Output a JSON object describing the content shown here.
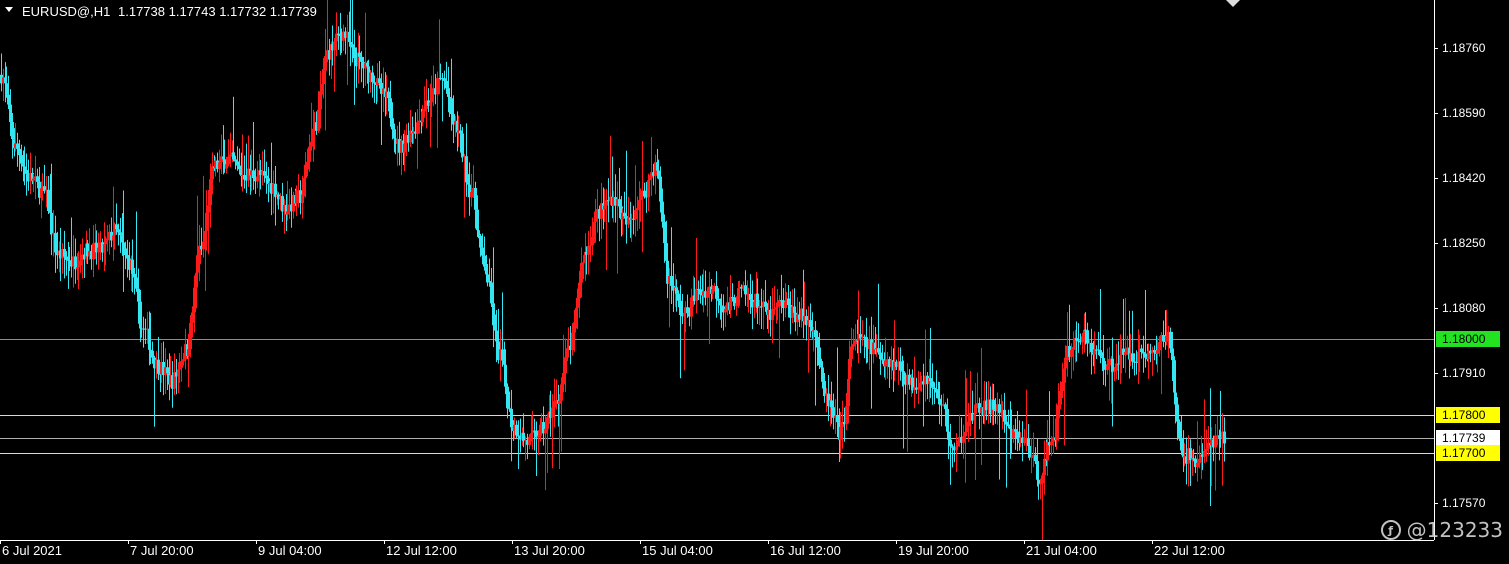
{
  "header": {
    "symbol": "EURUSD@,H1",
    "ohlc": "1.17738 1.17743 1.17732 1.17739",
    "menu_icon": "triangle-down-icon"
  },
  "watermark": {
    "text": "@123233",
    "icon": "brand-logo-icon"
  },
  "colors": {
    "background": "#000000",
    "bull": "#ff1a1a",
    "bear": "#33e6f2",
    "axis": "#ffffff",
    "green_line": "#2ecc40",
    "yellow_line": "#e8e85a",
    "current_line": "#b0b0b0"
  },
  "chart_data": {
    "type": "candlestick",
    "title": "",
    "xlabel": "",
    "ylabel": "",
    "ylim": [
      1.175,
      1.1888
    ],
    "y_ticks": [
      "1.18760",
      "1.18590",
      "1.18420",
      "1.18250",
      "1.18080",
      "1.17910",
      "1.17570"
    ],
    "x_ticks": [
      "6 Jul 2021",
      "7 Jul 20:00",
      "9 Jul 04:00",
      "12 Jul 12:00",
      "13 Jul 20:00",
      "15 Jul 04:00",
      "16 Jul 12:00",
      "19 Jul 20:00",
      "21 Jul 04:00",
      "22 Jul 12:00"
    ],
    "horizontal_levels": [
      {
        "label": "1.18000",
        "value": 1.18,
        "kind": "green"
      },
      {
        "label": "1.17800",
        "value": 1.178,
        "kind": "yellow"
      },
      {
        "label": "1.17739",
        "value": 1.17739,
        "kind": "current"
      },
      {
        "label": "1.17700",
        "value": 1.177,
        "kind": "yellow"
      }
    ],
    "close_path": [
      1.1869,
      1.185,
      1.1842,
      1.1838,
      1.1822,
      1.182,
      1.1823,
      1.1823,
      1.1828,
      1.182,
      1.1802,
      1.1793,
      1.1789,
      1.1797,
      1.1823,
      1.1845,
      1.1847,
      1.1843,
      1.1843,
      1.184,
      1.1834,
      1.1837,
      1.1855,
      1.1875,
      1.188,
      1.1873,
      1.1869,
      1.1863,
      1.185,
      1.1855,
      1.1862,
      1.1868,
      1.1855,
      1.1839,
      1.1818,
      1.1796,
      1.1777,
      1.1773,
      1.1776,
      1.1783,
      1.1798,
      1.1822,
      1.1833,
      1.1837,
      1.183,
      1.1837,
      1.1845,
      1.1815,
      1.1806,
      1.1812,
      1.1813,
      1.1808,
      1.1812,
      1.181,
      1.1806,
      1.1809,
      1.1806,
      1.1804,
      1.1784,
      1.1775,
      1.18,
      1.1798,
      1.1795,
      1.1793,
      1.1788,
      1.179,
      1.1784,
      1.177,
      1.1779,
      1.1782,
      1.1782,
      1.1775,
      1.1773,
      1.1764,
      1.1775,
      1.1797,
      1.1801,
      1.1796,
      1.1793,
      1.1796,
      1.1796,
      1.1796,
      1.1801,
      1.177,
      1.1768,
      1.1772,
      1.1774
    ]
  }
}
